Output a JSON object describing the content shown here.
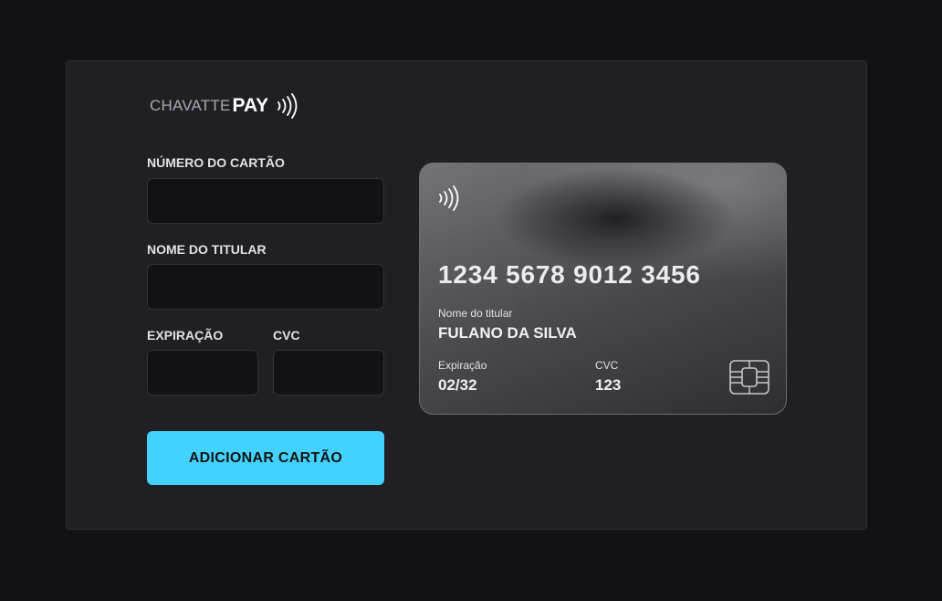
{
  "brand": {
    "name": "CHAVATTE",
    "suffix": "PAY",
    "icon": "contactless-icon"
  },
  "form": {
    "card_number": {
      "label": "NÚMERO DO CARTÃO",
      "value": "",
      "placeholder": ""
    },
    "holder_name": {
      "label": "NOME DO TITULAR",
      "value": "",
      "placeholder": ""
    },
    "expiration": {
      "label": "EXPIRAÇÃO",
      "value": "",
      "placeholder": ""
    },
    "cvc": {
      "label": "CVC",
      "value": "",
      "placeholder": ""
    },
    "submit_label": "ADICIONAR CARTÃO"
  },
  "card_preview": {
    "icon": "contactless-icon",
    "number": "1234 5678 9012 3456",
    "holder_label": "Nome do titular",
    "holder_value": "FULANO DA SILVA",
    "expiration_label": "Expiração",
    "expiration_value": "02/32",
    "cvc_label": "CVC",
    "cvc_value": "123",
    "chip_icon": "card-chip-icon"
  },
  "colors": {
    "page_background": "#121214",
    "panel_background": "#202024",
    "input_background": "#121214",
    "accent": "#43d2fd",
    "text": "#e1e1e6"
  }
}
